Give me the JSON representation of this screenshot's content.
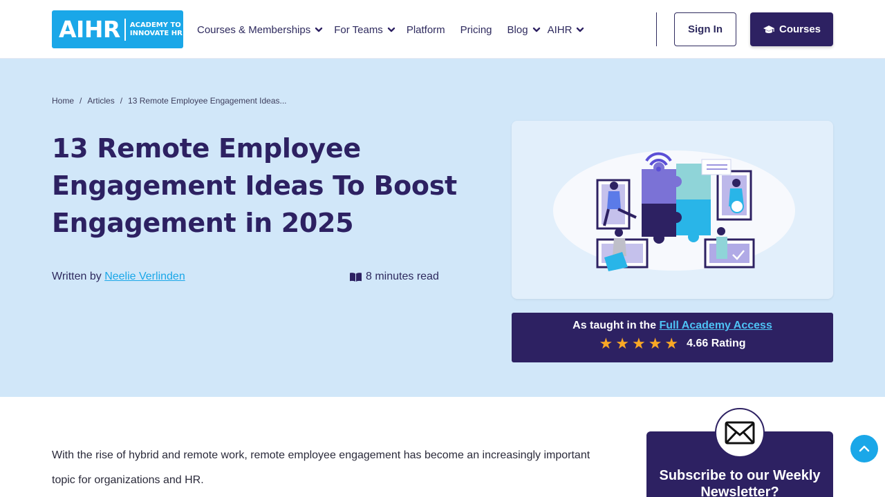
{
  "header": {
    "logo": {
      "mark": "AIHR",
      "tagline_1": "ACADEMY TO",
      "tagline_2": "INNOVATE HR"
    },
    "nav": [
      {
        "label": "Courses & Memberships",
        "has_dropdown": true
      },
      {
        "label": "For Teams",
        "has_dropdown": true
      },
      {
        "label": "Platform",
        "has_dropdown": false
      },
      {
        "label": "Pricing",
        "has_dropdown": false
      },
      {
        "label": "Blog",
        "has_dropdown": true
      },
      {
        "label": "AIHR",
        "has_dropdown": true
      }
    ],
    "signin_label": "Sign In",
    "courses_label": "Courses",
    "courses_icon": "graduation-cap-icon"
  },
  "hero": {
    "breadcrumb": [
      "Home",
      "Articles",
      "13 Remote Employee Engagement Ideas..."
    ],
    "title": "13 Remote Employee Engagement Ideas To Boost Engagement in 2025",
    "written_by_prefix": "Written by",
    "author": "Neelie Verlinden",
    "read_time": "8 minutes read",
    "taught_prefix": "As taught in the",
    "taught_link": "Full Academy Access",
    "stars": 5,
    "rating_text": "4.66 Rating"
  },
  "body": {
    "intro": "With the rise of hybrid and remote work, remote employee engagement has become an increasingly important topic for organizations and HR."
  },
  "newsletter": {
    "title": "Subscribe to our Weekly Newsletter?"
  },
  "colors": {
    "brand_navy": "#2d2162",
    "brand_blue": "#1aa7e8",
    "hero_bg": "#d1e7f9",
    "star": "#f9a825"
  }
}
